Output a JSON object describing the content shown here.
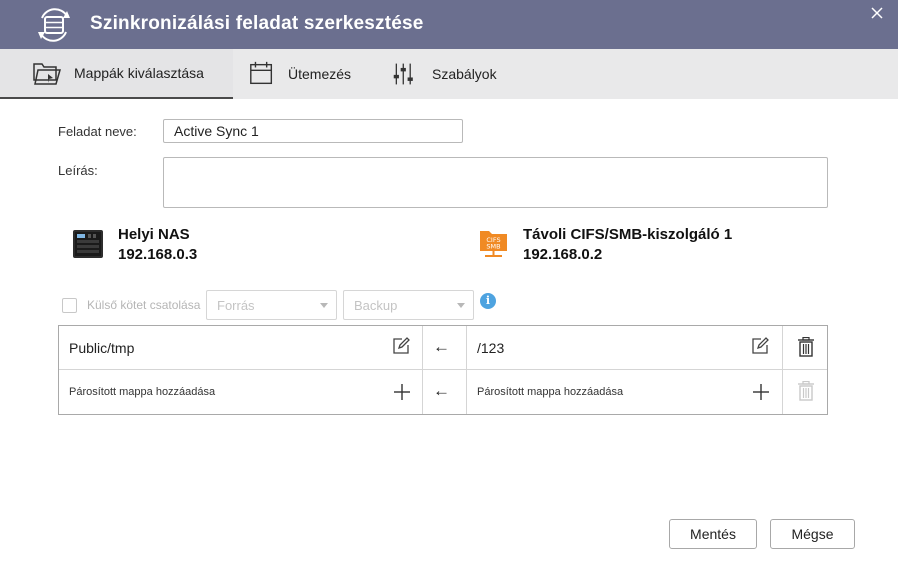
{
  "window": {
    "title": "Szinkronizálási feladat szerkesztése",
    "icon": "sync-task-icon",
    "close_icon": "close-icon"
  },
  "tabs": [
    {
      "label": "Mappák kiválasztása",
      "icon": "folder-select-icon",
      "active": true
    },
    {
      "label": "Ütemezés",
      "icon": "calendar-icon",
      "active": false
    },
    {
      "label": "Szabályok",
      "icon": "sliders-icon",
      "active": false
    }
  ],
  "form": {
    "task_name_label": "Feladat neve:",
    "task_name_value": "Active Sync 1",
    "description_label": "Leírás:",
    "description_value": ""
  },
  "local": {
    "name": "Helyi NAS",
    "ip": "192.168.0.3",
    "icon": "nas-device-icon"
  },
  "remote": {
    "name": "Távoli CIFS/SMB-kiszolgáló 1",
    "ip": "192.168.0.2",
    "icon": "cifs-smb-folder-icon",
    "icon_text_line1": "CIFS",
    "icon_text_line2": "SMB"
  },
  "external_volume": {
    "checkbox_label": "Külső kötet csatolása",
    "checked": false,
    "source_select": "Forrás",
    "backup_select": "Backup",
    "info_glyph": "i"
  },
  "pairs": [
    {
      "local_path": "Public/tmp",
      "arrow": "←",
      "remote_path": "/123"
    }
  ],
  "add_pair": {
    "local_text": "Párosított mappa hozzáadása",
    "arrow": "←",
    "remote_text": "Párosított mappa hozzáadása"
  },
  "buttons": {
    "save": "Mentés",
    "cancel": "Mégse"
  },
  "colors": {
    "titlebar": "#6b6f8f",
    "tabbar": "#e9e9ea",
    "info": "#4ea3e0",
    "remote_icon": "#f08a24"
  }
}
